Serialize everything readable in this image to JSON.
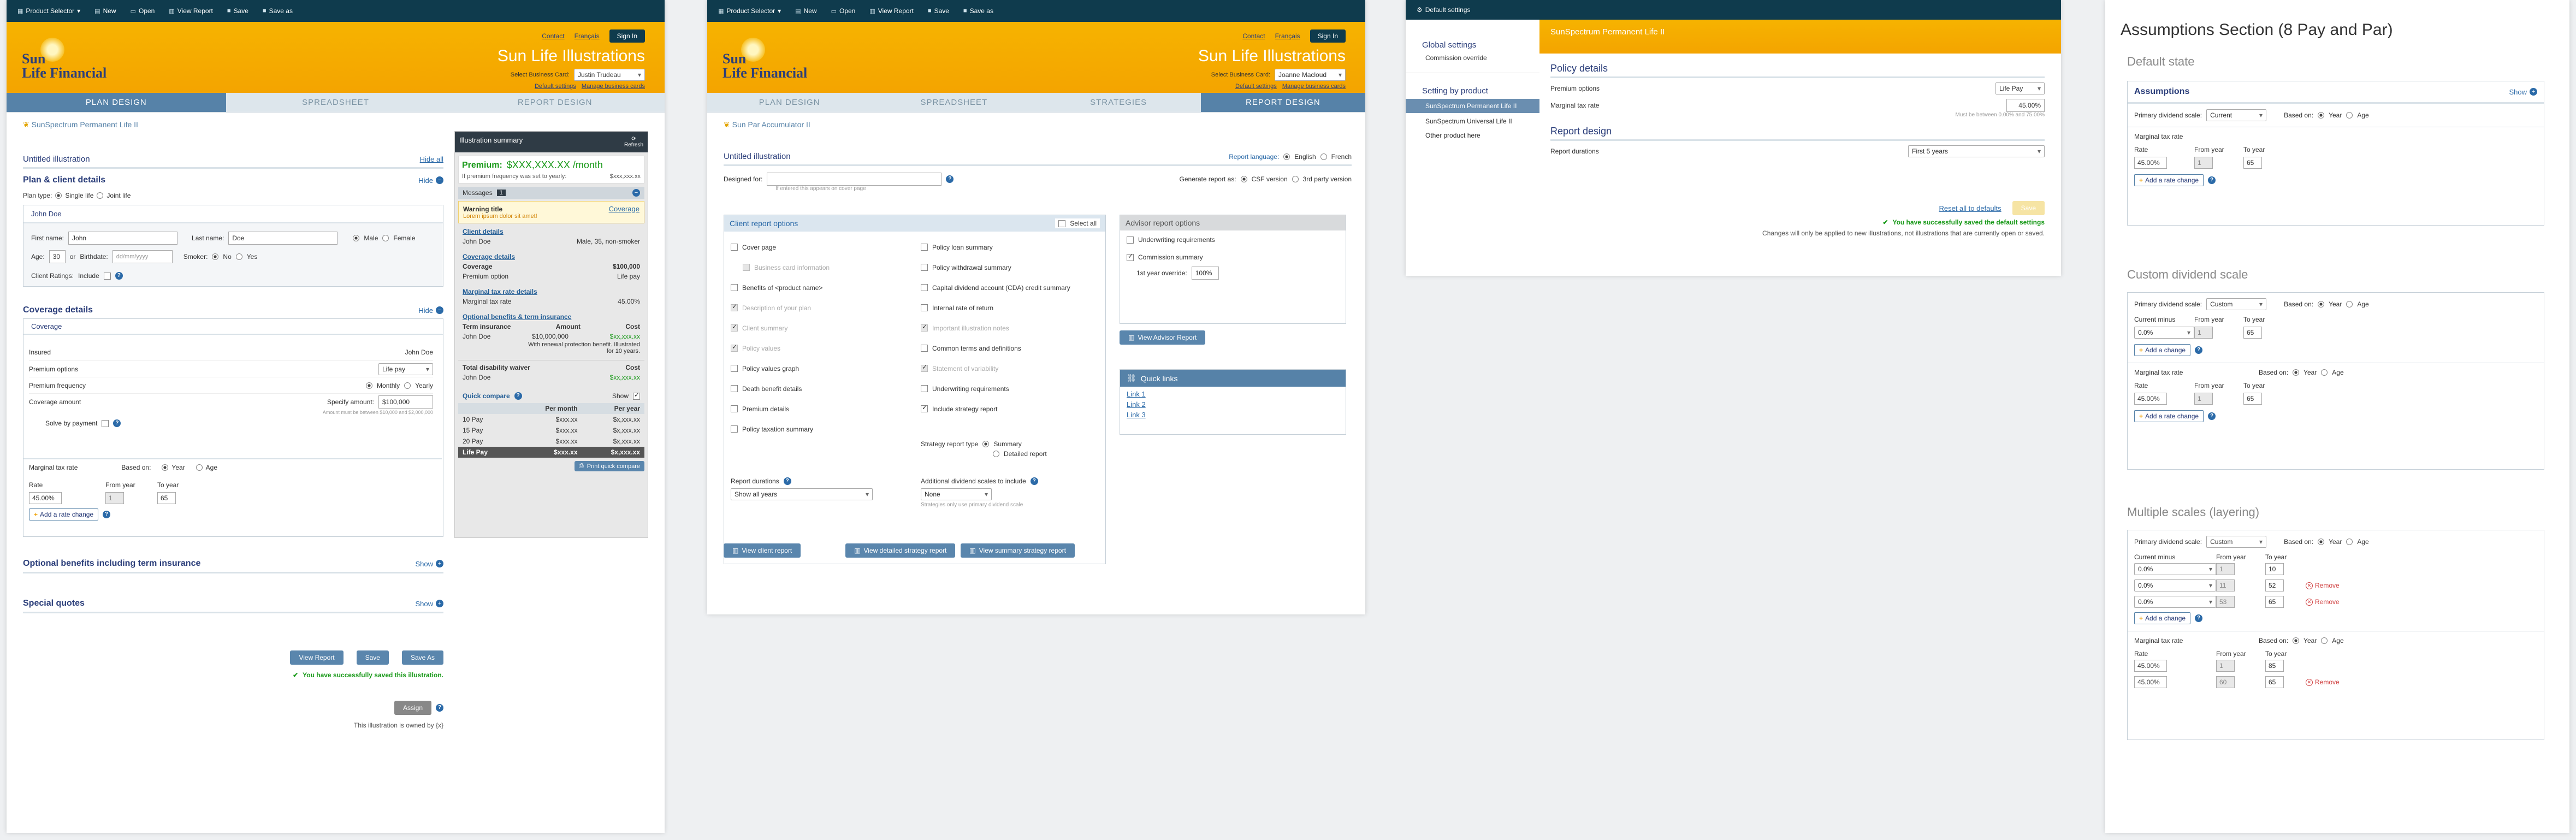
{
  "toolbar": {
    "product_selector": "Product Selector",
    "new": "New",
    "open": "Open",
    "view_report": "View Report",
    "save": "Save",
    "save_as": "Save as"
  },
  "header": {
    "contact": "Contact",
    "francais": "Français",
    "sign_in": "Sign In",
    "app_title": "Sun Life Illustrations",
    "business_card_label": "Select Business Card:",
    "business_card_1": "Justin Trudeau",
    "business_card_2": "Joanne Macloud",
    "default_settings": "Default settings",
    "manage_cards": "Manage business cards",
    "logo_line1": "Sun",
    "logo_line2": "Life Financial"
  },
  "tabs": {
    "plan_design": "PLAN DESIGN",
    "spreadsheet": "SPREADSHEET",
    "report_design": "REPORT DESIGN",
    "strategies": "STRATEGIES"
  },
  "p1": {
    "product": "SunSpectrum Permanent Life II",
    "title": "Untitled illustration",
    "hide_all": "Hide all",
    "plan_client": "Plan & client details",
    "hide": "Hide",
    "plan_type": "Plan type:",
    "single_life": "Single life",
    "joint_life": "Joint life",
    "insured_name": "John Doe",
    "first_name_label": "First name:",
    "first_name": "John",
    "last_name_label": "Last name:",
    "last_name": "Doe",
    "male": "Male",
    "female": "Female",
    "age_label": "Age:",
    "age": "30",
    "or": "or",
    "birthdate_label": "Birthdate:",
    "birthdate_ph": "dd/mm/yyyy",
    "smoker_label": "Smoker:",
    "no": "No",
    "yes": "Yes",
    "client_ratings": "Client Ratings:",
    "include": "Include",
    "coverage_details": "Coverage details",
    "coverage": "Coverage",
    "insured": "Insured",
    "insured_val": "John Doe",
    "premium_options": "Premium options",
    "premium_options_val": "Life pay",
    "premium_frequency": "Premium frequency",
    "monthly": "Monthly",
    "yearly": "Yearly",
    "coverage_amount": "Coverage amount",
    "specify_amount": "Specify amount:",
    "amount_val": "$100,000",
    "amount_note": "Amount must be between $10,000 and $2,000,000",
    "solve_by_payment": "Solve by payment",
    "marginal_tax_rate": "Marginal tax rate",
    "based_on": "Based on:",
    "year": "Year",
    "age_opt": "Age",
    "rate": "Rate",
    "from_year": "From year",
    "to_year": "To year",
    "rate_val": "45.00%",
    "from_val": "1",
    "to_val": "65",
    "add_rate_change": "Add a rate change",
    "optional_benefits": "Optional benefits including term insurance",
    "show": "Show",
    "special_quotes": "Special quotes",
    "view_report": "View Report",
    "save": "Save",
    "save_as": "Save As",
    "saved_msg": "You have successfully saved this illustration.",
    "assign": "Assign",
    "owned_by": "This illustration is owned by {x}"
  },
  "summary": {
    "title": "Illustration summary",
    "refresh": "Refresh",
    "premium_label": "Premium:",
    "premium_val": "$XXX,XXX.XX /month",
    "premium_note": "If premium frequency was set to yearly:",
    "premium_yearly": "$xxx,xxx.xx",
    "messages": "Messages",
    "msg_count": "1",
    "warning_title": "Warning title",
    "warning_text": "Lorem ipsum dolor sit amet!",
    "coverage_link": "Coverage",
    "client_details": "Client details",
    "client_name": "John Doe",
    "client_info": "Male, 35, non-smoker",
    "coverage_details": "Coverage details",
    "coverage_label": "Coverage",
    "coverage_val": "$100,000",
    "premium_option_label": "Premium option",
    "premium_option_val": "Life pay",
    "mtr_details": "Marginal tax rate details",
    "mtr_label": "Marginal tax rate",
    "mtr_val": "45.00%",
    "opt_benefits": "Optional benefits & term insurance",
    "term_insurance": "Term insurance",
    "amount": "Amount",
    "cost": "Cost",
    "term_name": "John Doe",
    "term_amount": "$10,000,000",
    "term_cost": "$xx,xxx.xx",
    "term_note": "With renewal protection benefit. Illustrated for 10 years.",
    "tdw": "Total disability waiver",
    "tdw_cost_label": "Cost",
    "tdw_name": "John Doe",
    "tdw_cost": "$xx,xxx.xx",
    "quick_compare": "Quick compare",
    "qc_show": "Show",
    "per_month": "Per month",
    "per_year": "Per year",
    "qc_rows": [
      {
        "label": "10 Pay",
        "month": "$xxx.xx",
        "year": "$x,xxx.xx"
      },
      {
        "label": "15 Pay",
        "month": "$xxx.xx",
        "year": "$x,xxx.xx"
      },
      {
        "label": "20 Pay",
        "month": "$xxx.xx",
        "year": "$x,xxx.xx"
      },
      {
        "label": "Life Pay",
        "month": "$xxx.xx",
        "year": "$x,xxx.xx"
      }
    ],
    "print_qc": "Print quick compare"
  },
  "p2": {
    "product": "Sun Par Accumulator II",
    "title": "Untitled illustration",
    "report_language": "Report language:",
    "english": "English",
    "french": "French",
    "designed_for": "Designed for:",
    "designed_note": "If entered this appears on cover page",
    "generate_as": "Generate report as:",
    "csf_version": "CSF version",
    "third_party": "3rd party version",
    "client_report_options": "Client report options",
    "select_all": "Select all",
    "col1": [
      {
        "label": "Cover page",
        "state": "off"
      },
      {
        "label": "Business card information",
        "state": "dis",
        "indent": true
      },
      {
        "label": "Benefits of <product name>",
        "state": "off"
      },
      {
        "label": "Description of your plan",
        "state": "dison"
      },
      {
        "label": "Client summary",
        "state": "dison"
      },
      {
        "label": "Policy values",
        "state": "dison"
      },
      {
        "label": "Policy values graph",
        "state": "off"
      },
      {
        "label": "Death benefit details",
        "state": "off"
      },
      {
        "label": "Premium details",
        "state": "off"
      },
      {
        "label": "Policy taxation summary",
        "state": "off"
      }
    ],
    "col2": [
      {
        "label": "Policy loan summary",
        "state": "off"
      },
      {
        "label": "Policy withdrawal summary",
        "state": "off"
      },
      {
        "label": "Capital dividend account (CDA) credit summary",
        "state": "off"
      },
      {
        "label": "Internal rate of return",
        "state": "off"
      },
      {
        "label": "Important illustration notes",
        "state": "dison"
      },
      {
        "label": "Common terms and definitions",
        "state": "off"
      },
      {
        "label": "Statement of variability",
        "state": "dison"
      },
      {
        "label": "Underwriting requirements",
        "state": "off"
      },
      {
        "label": "Include strategy report",
        "state": "on"
      }
    ],
    "strategy_report_type": "Strategy report type",
    "summary": "Summary",
    "detailed_report": "Detailed report",
    "report_durations": "Report durations",
    "show_all_years": "Show all years",
    "additional_div": "Additional dividend scales to include",
    "none": "None",
    "strategies_note": "Strategies only use primary dividend scale",
    "view_client_report": "View client report",
    "view_detailed_strategy": "View detailed strategy report",
    "view_summary_strategy": "View summary strategy report",
    "advisor_report_options": "Advisor report options",
    "underwriting": "Underwriting requirements",
    "commission_summary": "Commission summary",
    "first_year_override": "1st year override:",
    "override_val": "100%",
    "view_advisor_report": "View Advisor Report",
    "quick_links": "Quick links",
    "links": [
      "Link 1",
      "Link 2",
      "Link 3"
    ]
  },
  "p3": {
    "topbar_title": "Default settings",
    "global_settings": "Global settings",
    "commission_override": "Commission override",
    "setting_by_product": "Setting by product",
    "products": [
      "SunSpectrum Permanent Life II",
      "SunSpectrum Universal Life II",
      "Other product here"
    ],
    "banner_title": "SunSpectrum Permanent Life II",
    "policy_details": "Policy details",
    "premium_options": "Premium options",
    "premium_val": "Life Pay",
    "mtr": "Marginal tax rate",
    "mtr_val": "45.00%",
    "mtr_note": "Must be between 0.00% and 75.00%",
    "report_design": "Report design",
    "report_durations": "Report durations",
    "durations_val": "First 5 years",
    "reset": "Reset all to defaults",
    "save": "Save",
    "saved_msg": "You have successfully saved the default settings",
    "saved_note": "Changes will only be applied to new illustrations, not illustrations that are currently open or saved."
  },
  "p4": {
    "title": "Assumptions Section (8 Pay and Par)",
    "default_state": "Default state",
    "assumptions": "Assumptions",
    "show": "Show",
    "primary_div": "Primary dividend scale:",
    "current": "Current",
    "custom": "Custom",
    "based_on": "Based on:",
    "year": "Year",
    "age": "Age",
    "mtr": "Marginal tax rate",
    "rate": "Rate",
    "from_year": "From year",
    "to_year": "To year",
    "current_minus": "Current minus",
    "rate_val": "45.00%",
    "zero": "0.0%",
    "add_rate_change": "Add a rate change",
    "add_change": "Add a change",
    "custom_div": "Custom dividend scale",
    "multiple_scales": "Multiple scales (layering)",
    "remove": "Remove",
    "v1": "1",
    "v10": "10",
    "v11": "11",
    "v52": "52",
    "v53": "53",
    "v60": "60",
    "v65": "65",
    "v85": "85"
  }
}
